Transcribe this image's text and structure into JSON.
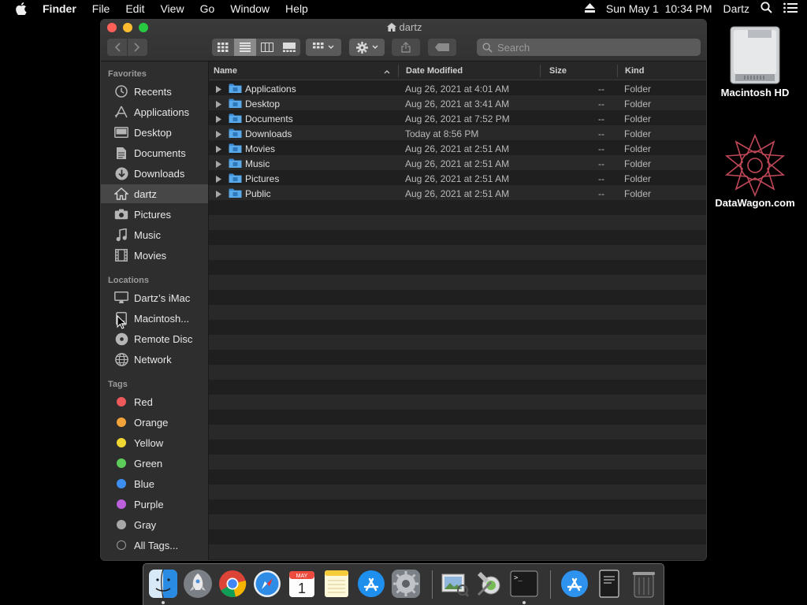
{
  "menubar": {
    "app_name": "Finder",
    "menus": [
      "File",
      "Edit",
      "View",
      "Go",
      "Window",
      "Help"
    ],
    "clock": "Sun May 1  10:34 PM",
    "user": "Dartz"
  },
  "window": {
    "title": "dartz",
    "search_placeholder": "Search"
  },
  "sidebar": {
    "favorites_header": "Favorites",
    "favorites": [
      {
        "label": "Recents",
        "icon": "clock-icon"
      },
      {
        "label": "Applications",
        "icon": "applications-icon"
      },
      {
        "label": "Desktop",
        "icon": "desktop-icon"
      },
      {
        "label": "Documents",
        "icon": "document-icon"
      },
      {
        "label": "Downloads",
        "icon": "download-icon"
      },
      {
        "label": "dartz",
        "icon": "home-icon",
        "selected": true
      },
      {
        "label": "Pictures",
        "icon": "camera-icon"
      },
      {
        "label": "Music",
        "icon": "music-note-icon"
      },
      {
        "label": "Movies",
        "icon": "film-icon"
      }
    ],
    "locations_header": "Locations",
    "locations": [
      {
        "label": "Dartz’s iMac",
        "icon": "imac-icon"
      },
      {
        "label": "Macintosh...",
        "icon": "drive-icon"
      },
      {
        "label": "Remote Disc",
        "icon": "disc-icon"
      },
      {
        "label": "Network",
        "icon": "globe-icon"
      }
    ],
    "tags_header": "Tags",
    "tags": [
      {
        "label": "Red",
        "color": "#ee5a5a"
      },
      {
        "label": "Orange",
        "color": "#f2a33a"
      },
      {
        "label": "Yellow",
        "color": "#f0d630"
      },
      {
        "label": "Green",
        "color": "#5ccc5a"
      },
      {
        "label": "Blue",
        "color": "#3c8ef0"
      },
      {
        "label": "Purple",
        "color": "#bc60dc"
      },
      {
        "label": "Gray",
        "color": "#a8a8a8"
      },
      {
        "label": "All Tags...",
        "color": "all"
      }
    ]
  },
  "columns": {
    "name": "Name",
    "date": "Date Modified",
    "size": "Size",
    "kind": "Kind"
  },
  "files": [
    {
      "name": "Applications",
      "date": "Aug 26, 2021 at 4:01 AM",
      "size": "--",
      "kind": "Folder"
    },
    {
      "name": "Desktop",
      "date": "Aug 26, 2021 at 3:41 AM",
      "size": "--",
      "kind": "Folder"
    },
    {
      "name": "Documents",
      "date": "Aug 26, 2021 at 7:52 PM",
      "size": "--",
      "kind": "Folder"
    },
    {
      "name": "Downloads",
      "date": "Today at 8:56 PM",
      "size": "--",
      "kind": "Folder"
    },
    {
      "name": "Movies",
      "date": "Aug 26, 2021 at 2:51 AM",
      "size": "--",
      "kind": "Folder"
    },
    {
      "name": "Music",
      "date": "Aug 26, 2021 at 2:51 AM",
      "size": "--",
      "kind": "Folder"
    },
    {
      "name": "Pictures",
      "date": "Aug 26, 2021 at 2:51 AM",
      "size": "--",
      "kind": "Folder"
    },
    {
      "name": "Public",
      "date": "Aug 26, 2021 at 2:51 AM",
      "size": "--",
      "kind": "Folder"
    }
  ],
  "desktop": {
    "icons": [
      {
        "label": "Macintosh HD",
        "icon": "hard-drive-icon"
      },
      {
        "label": "DataWagon.com",
        "icon": "geometric-star-icon"
      }
    ]
  },
  "dock": {
    "apps": [
      {
        "name": "finder-icon",
        "running": true
      },
      {
        "name": "launchpad-icon",
        "running": false
      },
      {
        "name": "chrome-icon",
        "running": false
      },
      {
        "name": "safari-icon",
        "running": false
      },
      {
        "name": "calendar-icon",
        "running": false,
        "month": "MAY",
        "day": "1"
      },
      {
        "name": "notes-icon",
        "running": false
      },
      {
        "name": "app-store-icon",
        "running": false
      },
      {
        "name": "system-preferences-icon",
        "running": false
      },
      {
        "name": "preview-icon",
        "running": false
      },
      {
        "name": "utilities-icon",
        "running": false
      },
      {
        "name": "terminal-icon",
        "running": true
      },
      {
        "name": "app-store-downloads-icon",
        "running": false
      },
      {
        "name": "document-stack-icon",
        "running": false
      },
      {
        "name": "trash-icon",
        "running": false
      }
    ]
  }
}
